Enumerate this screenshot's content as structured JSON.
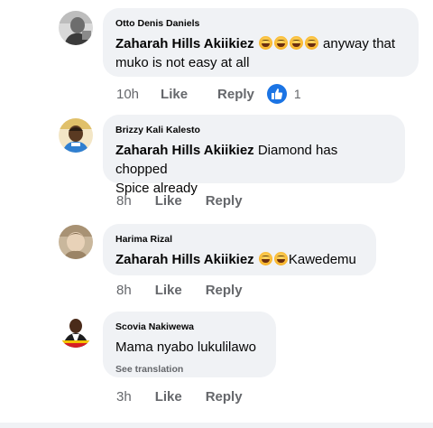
{
  "comments": [
    {
      "author": "Otto Denis Daniels",
      "mention": "Zaharah Hills Akiikiez",
      "text_line1": "anyway that",
      "text_line2": "muko is not easy at all",
      "time": "10h",
      "like_label": "Like",
      "reply_label": "Reply",
      "reaction_count": "1"
    },
    {
      "author": "Brizzy Kali Kalesto",
      "mention": "Zaharah Hills Akiikiez",
      "text_line1": "Diamond has chopped",
      "text_line2": "Spice already",
      "time": "8h",
      "like_label": "Like",
      "reply_label": "Reply"
    },
    {
      "author": "Harima Rizal",
      "mention": "Zaharah Hills Akiikiez",
      "text_line1": "Kawedemu",
      "time": "8h",
      "like_label": "Like",
      "reply_label": "Reply"
    },
    {
      "author": "Scovia Nakiwewa",
      "text_line1": "Mama nyabo lukulilawo",
      "see_translation": "See translation",
      "time": "3h",
      "like_label": "Like",
      "reply_label": "Reply"
    }
  ],
  "colors": {
    "bubble": "#f0f2f5",
    "meta_text": "#65676b",
    "like_badge": "#1b74e4"
  },
  "icons": {
    "emoji": "rolling-on-floor-laughing-emoji",
    "reaction": "thumbs-up-icon"
  }
}
